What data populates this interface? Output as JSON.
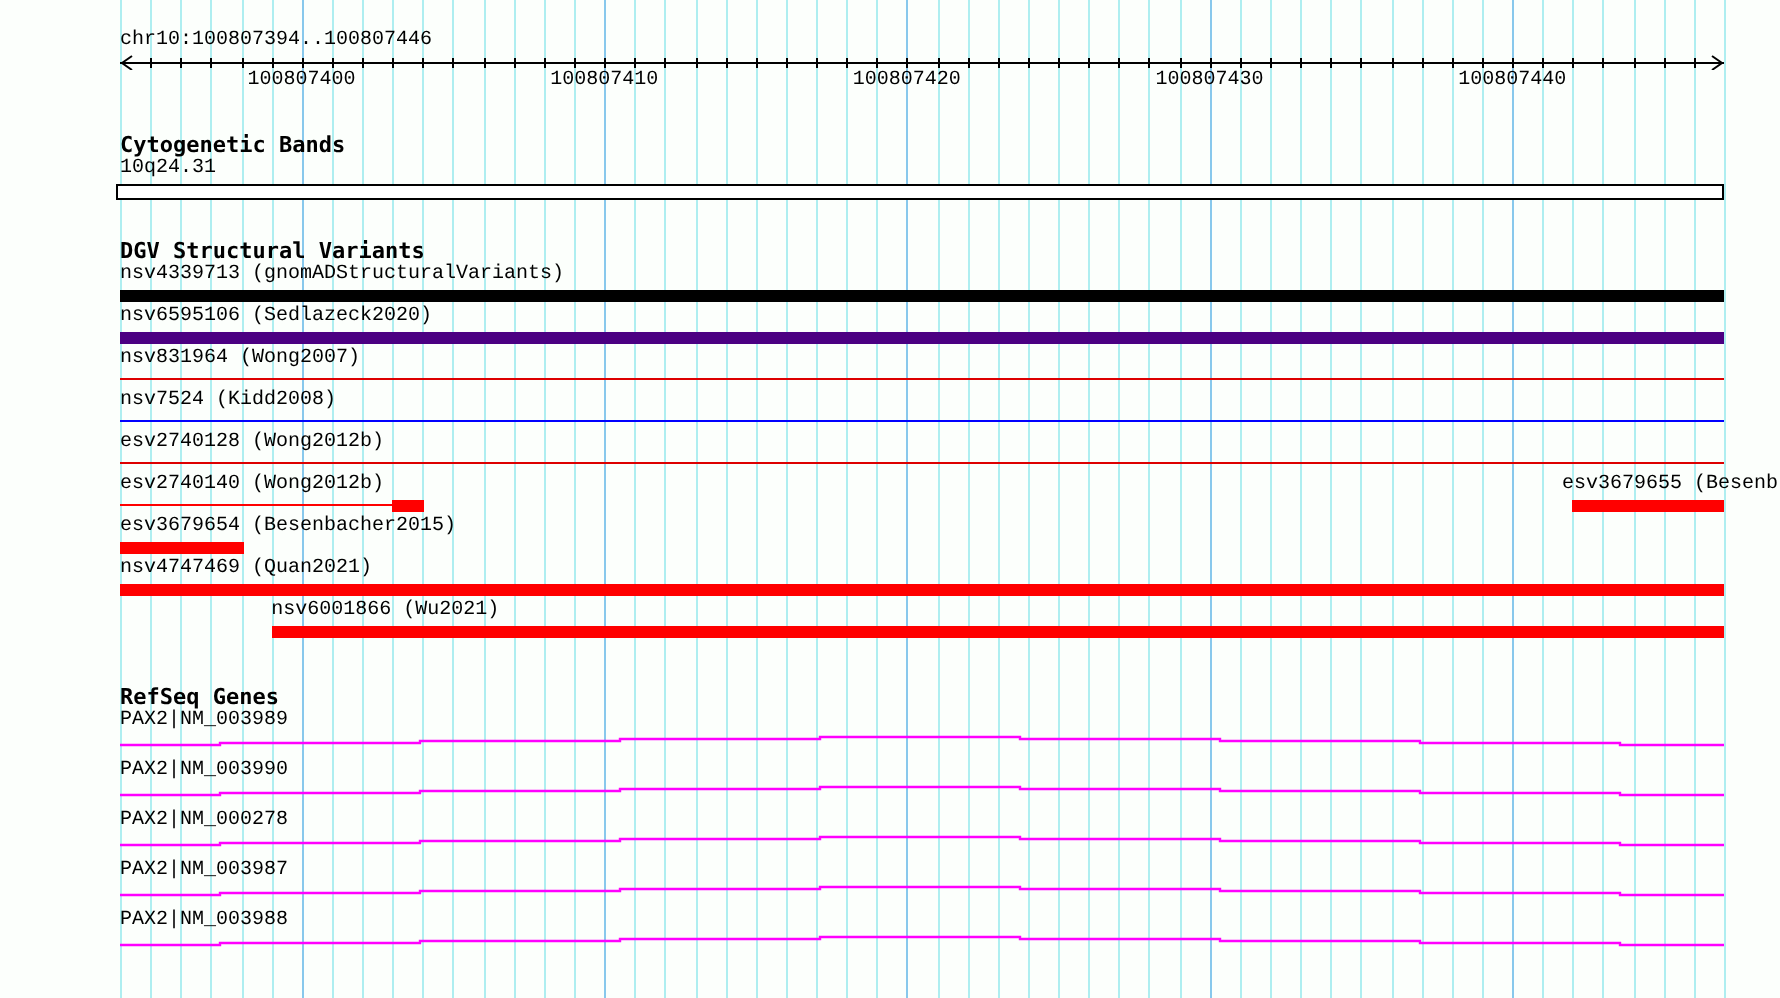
{
  "ruler": {
    "position": "chr10:100807394..100807446",
    "ticks": [
      "100807400",
      "100807410",
      "100807420",
      "100807430",
      "100807440"
    ]
  },
  "tracks": [
    {
      "kind": "cytoband",
      "title": "Cytogenetic Bands",
      "features": [
        {
          "label": "10q24.31"
        }
      ]
    },
    {
      "kind": "variants",
      "title": "DGV Structural Variants",
      "rows": [
        [
          {
            "label": "nsv4339713 (gnomADStructuralVariants)",
            "color": "#000000",
            "kind": "thick"
          }
        ],
        [
          {
            "label": "nsv6595106 (Sedlazeck2020)",
            "color": "#4b0082",
            "kind": "thick"
          }
        ],
        [
          {
            "label": "nsv831964 (Wong2007)",
            "color": "#dd0000",
            "kind": "thin"
          }
        ],
        [
          {
            "label": "nsv7524 (Kidd2008)",
            "color": "#0000ff",
            "kind": "thin"
          }
        ],
        [
          {
            "label": "esv2740128 (Wong2012b)",
            "color": "#dd0000",
            "kind": "thin"
          }
        ],
        [
          {
            "label": "esv2740140 (Wong2012b)",
            "color": "#ff0000",
            "kind": "partial"
          },
          {
            "label": "esv3679655 (Besenb",
            "color": "#ff0000",
            "kind": "thick"
          }
        ],
        [
          {
            "label": "esv3679654 (Besenbacher2015)",
            "color": "#ff0000",
            "kind": "thick"
          }
        ],
        [
          {
            "label": "nsv4747469 (Quan2021)",
            "color": "#ff0000",
            "kind": "thick"
          }
        ],
        [
          {
            "label": "nsv6001866 (Wu2021)",
            "color": "#ff0000",
            "kind": "thick"
          }
        ]
      ]
    },
    {
      "kind": "genes",
      "title": "RefSeq Genes",
      "features": [
        {
          "label": "PAX2|NM_003989"
        },
        {
          "label": "PAX2|NM_003990"
        },
        {
          "label": "PAX2|NM_000278"
        },
        {
          "label": "PAX2|NM_003987"
        },
        {
          "label": "PAX2|NM_003988"
        }
      ]
    }
  ]
}
